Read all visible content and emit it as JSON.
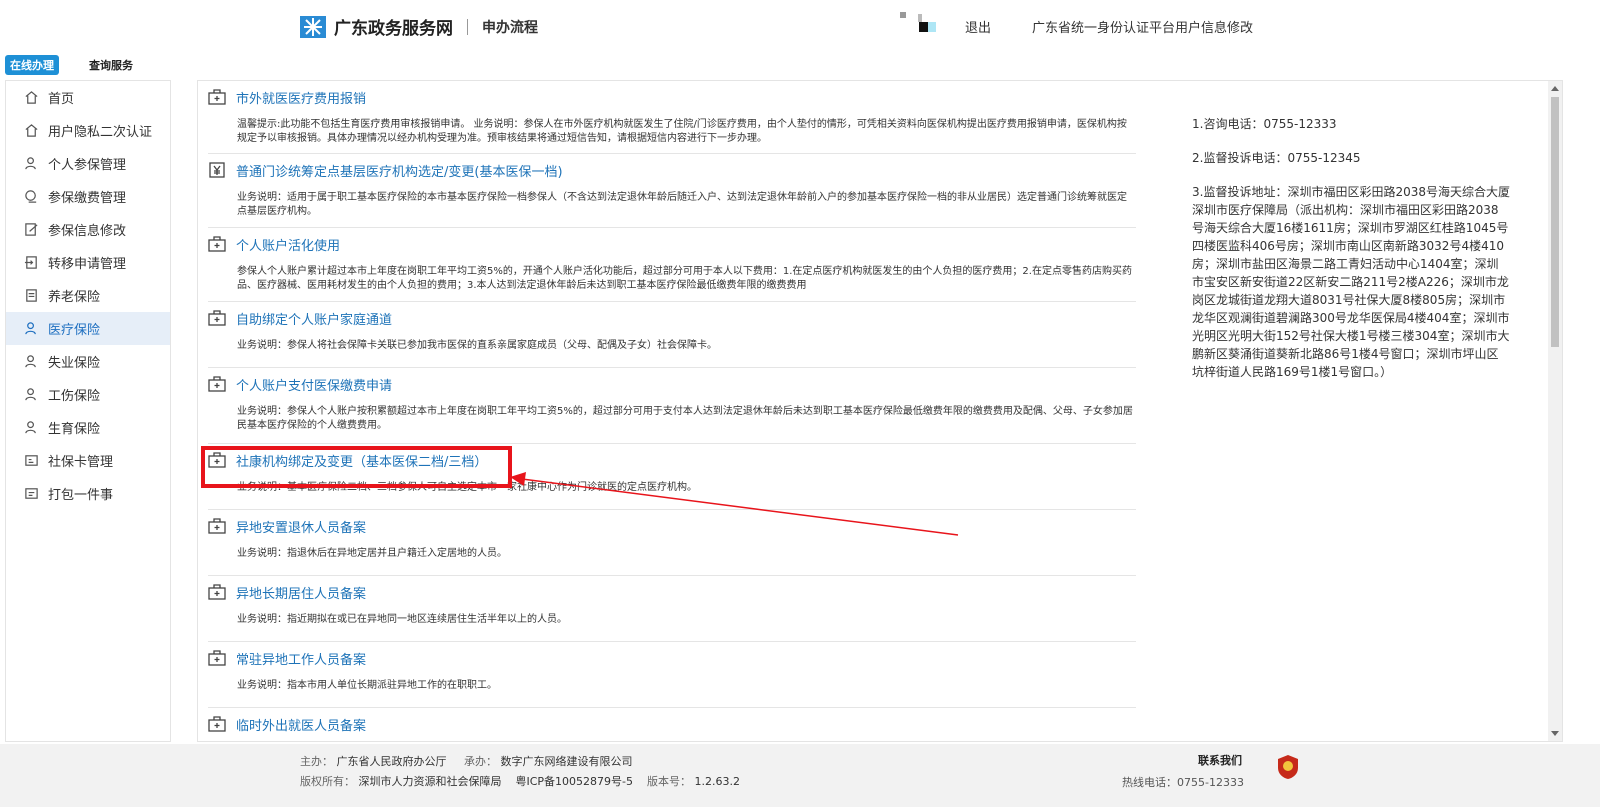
{
  "header": {
    "site_name": "广东政务服务网",
    "section": "申办流程",
    "logout": "退出",
    "profile_link": "广东省统一身份认证平台用户信息修改"
  },
  "tabs": [
    "在线办理",
    "查询服务"
  ],
  "sidebar": {
    "items": [
      {
        "label": "首页",
        "icon": "home-icon"
      },
      {
        "label": "用户隐私二次认证",
        "icon": "home-icon"
      },
      {
        "label": "个人参保管理",
        "icon": "person-icon"
      },
      {
        "label": "参保缴费管理",
        "icon": "payment-icon"
      },
      {
        "label": "参保信息修改",
        "icon": "edit-icon"
      },
      {
        "label": "转移申请管理",
        "icon": "transfer-icon"
      },
      {
        "label": "养老保险",
        "icon": "document-icon"
      },
      {
        "label": "医疗保险",
        "icon": "person-icon"
      },
      {
        "label": "失业保险",
        "icon": "person-icon"
      },
      {
        "label": "工伤保险",
        "icon": "person-icon"
      },
      {
        "label": "生育保险",
        "icon": "person-icon"
      },
      {
        "label": "社保卡管理",
        "icon": "card-icon"
      },
      {
        "label": "打包一件事",
        "icon": "package-icon"
      }
    ],
    "active": "医疗保险"
  },
  "services": [
    {
      "title": "市外就医医疗费用报销",
      "icon": "medical-kit-icon",
      "desc": "温馨提示:此功能不包括生育医疗费用审核报销申请。 业务说明：参保人在市外医疗机构就医发生了住院/门诊医疗费用，由个人垫付的情形，可凭相关资料向医保机构提出医疗费用报销申请，医保机构按规定予以审核报销。具体办理情况以经办机构受理为准。预审核结果将通过短信告知，请根据短信内容进行下一步办理。"
    },
    {
      "title": "普通门诊统筹定点基层医疗机构选定/变更(基本医保一档)",
      "icon": "yuan-icon",
      "desc": "业务说明：适用于属于职工基本医疗保险的本市基本医疗保险一档参保人（不含达到法定退休年龄后随迁入户、达到法定退休年龄前入户的参加基本医疗保险一档的非从业居民）选定普通门诊统筹就医定点基层医疗机构。"
    },
    {
      "title": "个人账户活化使用",
      "icon": "medical-kit-icon",
      "desc": "参保人个人账户累计超过本市上年度在岗职工年平均工资5%的，开通个人账户活化功能后，超过部分可用于本人以下费用：1.在定点医疗机构就医发生的由个人负担的医疗费用；2.在定点零售药店购买药品、医疗器械、医用耗材发生的由个人负担的费用；3.本人达到法定退休年龄后未达到职工基本医疗保险最低缴费年限的缴费费用"
    },
    {
      "title": "自助绑定个人账户家庭通道",
      "icon": "medical-kit-icon",
      "desc": "业务说明：参保人将社会保障卡关联已参加我市医保的直系亲属家庭成员（父母、配偶及子女）社会保障卡。"
    },
    {
      "title": "个人账户支付医保缴费申请",
      "icon": "medical-kit-icon",
      "desc": "业务说明：参保人个人账户按积累额超过本市上年度在岗职工年平均工资5%的，超过部分可用于支付本人达到法定退休年龄后未达到职工基本医疗保险最低缴费年限的缴费费用及配偶、父母、子女参加居民基本医疗保险的个人缴费费用。"
    },
    {
      "title": "社康机构绑定及变更（基本医保二档/三档）",
      "icon": "medical-kit-icon",
      "desc": "业务说明：基本医疗保险二档、三档参保人可自主选定本市一家社康中心作为门诊就医的定点医疗机构。"
    },
    {
      "title": "异地安置退休人员备案",
      "icon": "medical-kit-icon",
      "desc": "业务说明：指退休后在异地定居并且户籍迁入定居地的人员。"
    },
    {
      "title": "异地长期居住人员备案",
      "icon": "medical-kit-icon",
      "desc": "业务说明：指近期拟在或已在异地同一地区连续居住生活半年以上的人员。"
    },
    {
      "title": "常驻异地工作人员备案",
      "icon": "medical-kit-icon",
      "desc": "业务说明：指本市用人单位长期派驻异地工作的在职职工。"
    },
    {
      "title": "临时外出就医人员备案",
      "icon": "medical-kit-icon",
      "desc": ""
    }
  ],
  "info": {
    "line1": "1.咨询电话：0755-12333",
    "line2": "2.监督投诉电话：0755-12345",
    "line3": "3.监督投诉地址：深圳市福田区彩田路2038号海天综合大厦深圳市医疗保障局（派出机构：深圳市福田区彩田路2038号海天综合大厦16楼1611房；深圳市罗湖区红桂路1045号四楼医监科406号房；深圳市南山区南新路3032号4楼410房；深圳市盐田区海景二路工青妇活动中心1404室；深圳市宝安区新安街道22区新安二路211号2楼A226；深圳市龙岗区龙城街道龙翔大道8031号社保大厦8楼805房；深圳市龙华区观澜街道碧澜路300号龙华医保局4楼404室；深圳市光明区光明大街152号社保大楼1号楼三楼304室；深圳市大鹏新区葵涌街道葵新北路86号1楼4号窗口；深圳市坪山区坑梓街道人民路169号1楼1号窗口。）"
  },
  "footer": {
    "host_label": "主办：",
    "host": "广东省人民政府办公厅",
    "undertake_label": "承办：",
    "undertake": "数字广东网络建设有限公司",
    "copyright_label": "版权所有：",
    "copyright": "深圳市人力资源和社会保障局",
    "icp": "粤ICP备10052879号-5",
    "version_label": "版本号：",
    "version": "1.2.63.2",
    "contact": "联系我们",
    "hotline": "热线电话：0755-12333"
  },
  "colors": {
    "accent": "#1e90d6",
    "link": "#1e73b8",
    "highlight": "#e8141b",
    "active_bg": "#e6eef8"
  }
}
